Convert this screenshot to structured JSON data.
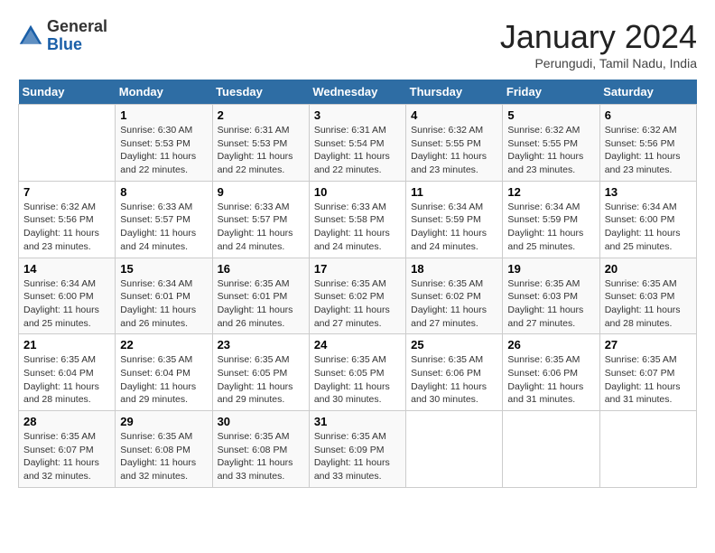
{
  "header": {
    "logo_general": "General",
    "logo_blue": "Blue",
    "month_title": "January 2024",
    "location": "Perungudi, Tamil Nadu, India"
  },
  "weekdays": [
    "Sunday",
    "Monday",
    "Tuesday",
    "Wednesday",
    "Thursday",
    "Friday",
    "Saturday"
  ],
  "weeks": [
    [
      {
        "day": "",
        "text": ""
      },
      {
        "day": "1",
        "text": "Sunrise: 6:30 AM\nSunset: 5:53 PM\nDaylight: 11 hours and 22 minutes."
      },
      {
        "day": "2",
        "text": "Sunrise: 6:31 AM\nSunset: 5:53 PM\nDaylight: 11 hours and 22 minutes."
      },
      {
        "day": "3",
        "text": "Sunrise: 6:31 AM\nSunset: 5:54 PM\nDaylight: 11 hours and 22 minutes."
      },
      {
        "day": "4",
        "text": "Sunrise: 6:32 AM\nSunset: 5:55 PM\nDaylight: 11 hours and 23 minutes."
      },
      {
        "day": "5",
        "text": "Sunrise: 6:32 AM\nSunset: 5:55 PM\nDaylight: 11 hours and 23 minutes."
      },
      {
        "day": "6",
        "text": "Sunrise: 6:32 AM\nSunset: 5:56 PM\nDaylight: 11 hours and 23 minutes."
      }
    ],
    [
      {
        "day": "7",
        "text": "Sunrise: 6:32 AM\nSunset: 5:56 PM\nDaylight: 11 hours and 23 minutes."
      },
      {
        "day": "8",
        "text": "Sunrise: 6:33 AM\nSunset: 5:57 PM\nDaylight: 11 hours and 24 minutes."
      },
      {
        "day": "9",
        "text": "Sunrise: 6:33 AM\nSunset: 5:57 PM\nDaylight: 11 hours and 24 minutes."
      },
      {
        "day": "10",
        "text": "Sunrise: 6:33 AM\nSunset: 5:58 PM\nDaylight: 11 hours and 24 minutes."
      },
      {
        "day": "11",
        "text": "Sunrise: 6:34 AM\nSunset: 5:59 PM\nDaylight: 11 hours and 24 minutes."
      },
      {
        "day": "12",
        "text": "Sunrise: 6:34 AM\nSunset: 5:59 PM\nDaylight: 11 hours and 25 minutes."
      },
      {
        "day": "13",
        "text": "Sunrise: 6:34 AM\nSunset: 6:00 PM\nDaylight: 11 hours and 25 minutes."
      }
    ],
    [
      {
        "day": "14",
        "text": "Sunrise: 6:34 AM\nSunset: 6:00 PM\nDaylight: 11 hours and 25 minutes."
      },
      {
        "day": "15",
        "text": "Sunrise: 6:34 AM\nSunset: 6:01 PM\nDaylight: 11 hours and 26 minutes."
      },
      {
        "day": "16",
        "text": "Sunrise: 6:35 AM\nSunset: 6:01 PM\nDaylight: 11 hours and 26 minutes."
      },
      {
        "day": "17",
        "text": "Sunrise: 6:35 AM\nSunset: 6:02 PM\nDaylight: 11 hours and 27 minutes."
      },
      {
        "day": "18",
        "text": "Sunrise: 6:35 AM\nSunset: 6:02 PM\nDaylight: 11 hours and 27 minutes."
      },
      {
        "day": "19",
        "text": "Sunrise: 6:35 AM\nSunset: 6:03 PM\nDaylight: 11 hours and 27 minutes."
      },
      {
        "day": "20",
        "text": "Sunrise: 6:35 AM\nSunset: 6:03 PM\nDaylight: 11 hours and 28 minutes."
      }
    ],
    [
      {
        "day": "21",
        "text": "Sunrise: 6:35 AM\nSunset: 6:04 PM\nDaylight: 11 hours and 28 minutes."
      },
      {
        "day": "22",
        "text": "Sunrise: 6:35 AM\nSunset: 6:04 PM\nDaylight: 11 hours and 29 minutes."
      },
      {
        "day": "23",
        "text": "Sunrise: 6:35 AM\nSunset: 6:05 PM\nDaylight: 11 hours and 29 minutes."
      },
      {
        "day": "24",
        "text": "Sunrise: 6:35 AM\nSunset: 6:05 PM\nDaylight: 11 hours and 30 minutes."
      },
      {
        "day": "25",
        "text": "Sunrise: 6:35 AM\nSunset: 6:06 PM\nDaylight: 11 hours and 30 minutes."
      },
      {
        "day": "26",
        "text": "Sunrise: 6:35 AM\nSunset: 6:06 PM\nDaylight: 11 hours and 31 minutes."
      },
      {
        "day": "27",
        "text": "Sunrise: 6:35 AM\nSunset: 6:07 PM\nDaylight: 11 hours and 31 minutes."
      }
    ],
    [
      {
        "day": "28",
        "text": "Sunrise: 6:35 AM\nSunset: 6:07 PM\nDaylight: 11 hours and 32 minutes."
      },
      {
        "day": "29",
        "text": "Sunrise: 6:35 AM\nSunset: 6:08 PM\nDaylight: 11 hours and 32 minutes."
      },
      {
        "day": "30",
        "text": "Sunrise: 6:35 AM\nSunset: 6:08 PM\nDaylight: 11 hours and 33 minutes."
      },
      {
        "day": "31",
        "text": "Sunrise: 6:35 AM\nSunset: 6:09 PM\nDaylight: 11 hours and 33 minutes."
      },
      {
        "day": "",
        "text": ""
      },
      {
        "day": "",
        "text": ""
      },
      {
        "day": "",
        "text": ""
      }
    ]
  ]
}
